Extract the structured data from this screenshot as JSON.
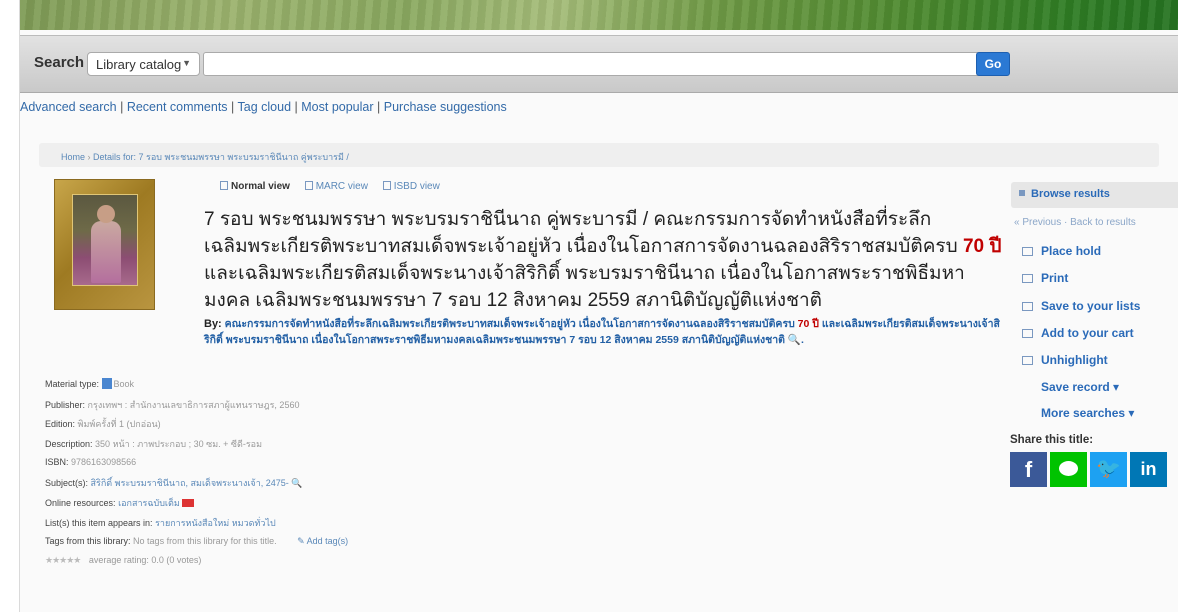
{
  "search": {
    "label": "Search",
    "scope": "Library catalog",
    "query": "",
    "go_label": "Go"
  },
  "more_searches": [
    "Advanced search",
    "Recent comments",
    "Tag cloud",
    "Most popular",
    "Purchase suggestions"
  ],
  "breadcrumbs": {
    "home": "Home",
    "current": "Details for: 7 รอบ พระชนมพรรษา พระบรมราชินีนาถ คู่พระบารมี /"
  },
  "views": {
    "normal": "Normal view",
    "marc": "MARC view",
    "isbd": "ISBD view"
  },
  "record": {
    "title_part1": "7 รอบ พระชนมพรรษา พระบรมราชินีนาถ คู่พระบารมี / คณะกรรมการจัดทำหนังสือที่ระลึก เฉลิมพระเกียรติพระบาทสมเด็จพระเจ้าอยู่หัว เนื่องในโอกาสการจัดงานฉลองสิริราชสมบัติครบ ",
    "title_highlight": "70 ปี",
    "title_part2": " และเฉลิมพระเกียรติสมเด็จพระนางเจ้าสิริกิติ์ พระบรมราชินีนาถ เนื่องในโอกาสพระราชพิธีมหามงคล เฉลิมพระชนมพรรษา 7 รอบ 12 สิงหาคม 2559 สภานิติบัญญัติแห่งชาติ",
    "by_label": "By:",
    "author_part1": "คณะกรรมการจัดทำหนังสือที่ระลึกเฉลิมพระเกียรติพระบาทสมเด็จพระเจ้าอยู่หัว เนื่องในโอกาสการจัดงานฉลองสิริราชสมบัติครบ ",
    "author_highlight": "70 ปี",
    "author_part2": " และเฉลิมพระเกียรติสมเด็จพระนางเจ้าสิริกิติ์ พระบรมราชินีนาถ เนื่องในโอกาสพระราชพิธีมหามงคลเฉลิมพระชนมพรรษา 7 รอบ 12 สิงหาคม 2559 สภานิติบัญญัติแห่งชาติ",
    "author_suffix": "."
  },
  "details": {
    "material_label": "Material type:",
    "material_value": "Book",
    "publisher_label": "Publisher:",
    "publisher_value": "กรุงเทพฯ : สำนักงานเลขาธิการสภาผู้แทนราษฎร, 2560",
    "edition_label": "Edition:",
    "edition_value": "พิมพ์ครั้งที่ 1 (ปกอ่อน)",
    "description_label": "Description:",
    "description_value": "350 หน้า : ภาพประกอบ ; 30 ซม. + ซีดี-รอม",
    "isbn_label": "ISBN:",
    "isbn_value": "9786163098566",
    "subjects_label": "Subject(s):",
    "subjects_value": "สิริกิติ์ พระบรมราชินีนาถ, สมเด็จพระนางเจ้า, 2475-",
    "online_label": "Online resources:",
    "online_value": "เอกสารฉบับเต็ม",
    "lists_label": "List(s) this item appears in:",
    "lists_value": "รายการหนังสือใหม่ หมวดทั่วไป",
    "tags_label": "Tags from this library:",
    "tags_value": "No tags from this library for this title.",
    "add_tags": "Add tag(s)",
    "stars": "★★★★★",
    "rating": "average rating: 0.0 (0 votes)"
  },
  "sidebar": {
    "browse_label": "Browse results",
    "previous": "« Previous",
    "back": "Back to results",
    "actions": [
      "Place hold",
      "Print",
      "Save to your lists",
      "Add to your cart",
      "Unhighlight"
    ],
    "save_record": "Save record ▾",
    "more_searches": "More searches ▾",
    "share_label": "Share this title:"
  },
  "colors": {
    "accent": "#2a6ab8",
    "go_button": "#2b79d4",
    "highlight": "#c00000",
    "facebook": "#3b5998",
    "line": "#00c300",
    "twitter": "#1da1f2",
    "linkedin": "#0077b5"
  }
}
